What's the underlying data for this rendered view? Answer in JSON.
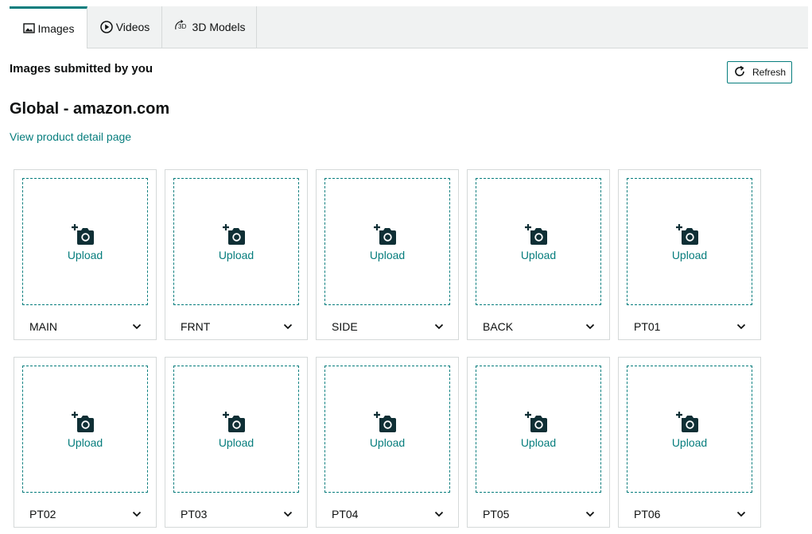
{
  "tabs": [
    {
      "label": "Images",
      "icon": "image-icon",
      "active": true
    },
    {
      "label": "Videos",
      "icon": "play-circle-icon",
      "active": false
    },
    {
      "label": "3D Models",
      "icon": "3d-rotate-icon",
      "icon_text": "3D",
      "active": false
    }
  ],
  "header": {
    "section_title": "Images submitted by you",
    "refresh_label": "Refresh",
    "marketplace_title": "Global - amazon.com",
    "detail_link": "View product detail page"
  },
  "slots": [
    {
      "variant": "MAIN",
      "upload_label": "Upload"
    },
    {
      "variant": "FRNT",
      "upload_label": "Upload"
    },
    {
      "variant": "SIDE",
      "upload_label": "Upload"
    },
    {
      "variant": "BACK",
      "upload_label": "Upload"
    },
    {
      "variant": "PT01",
      "upload_label": "Upload"
    },
    {
      "variant": "PT02",
      "upload_label": "Upload"
    },
    {
      "variant": "PT03",
      "upload_label": "Upload"
    },
    {
      "variant": "PT04",
      "upload_label": "Upload"
    },
    {
      "variant": "PT05",
      "upload_label": "Upload"
    },
    {
      "variant": "PT06",
      "upload_label": "Upload"
    }
  ],
  "colors": {
    "accent": "#067d7d",
    "icon_dark": "#0f2f35",
    "tab_bg": "#f0f2f2",
    "border": "#d5d9d9",
    "text": "#0f1111"
  }
}
